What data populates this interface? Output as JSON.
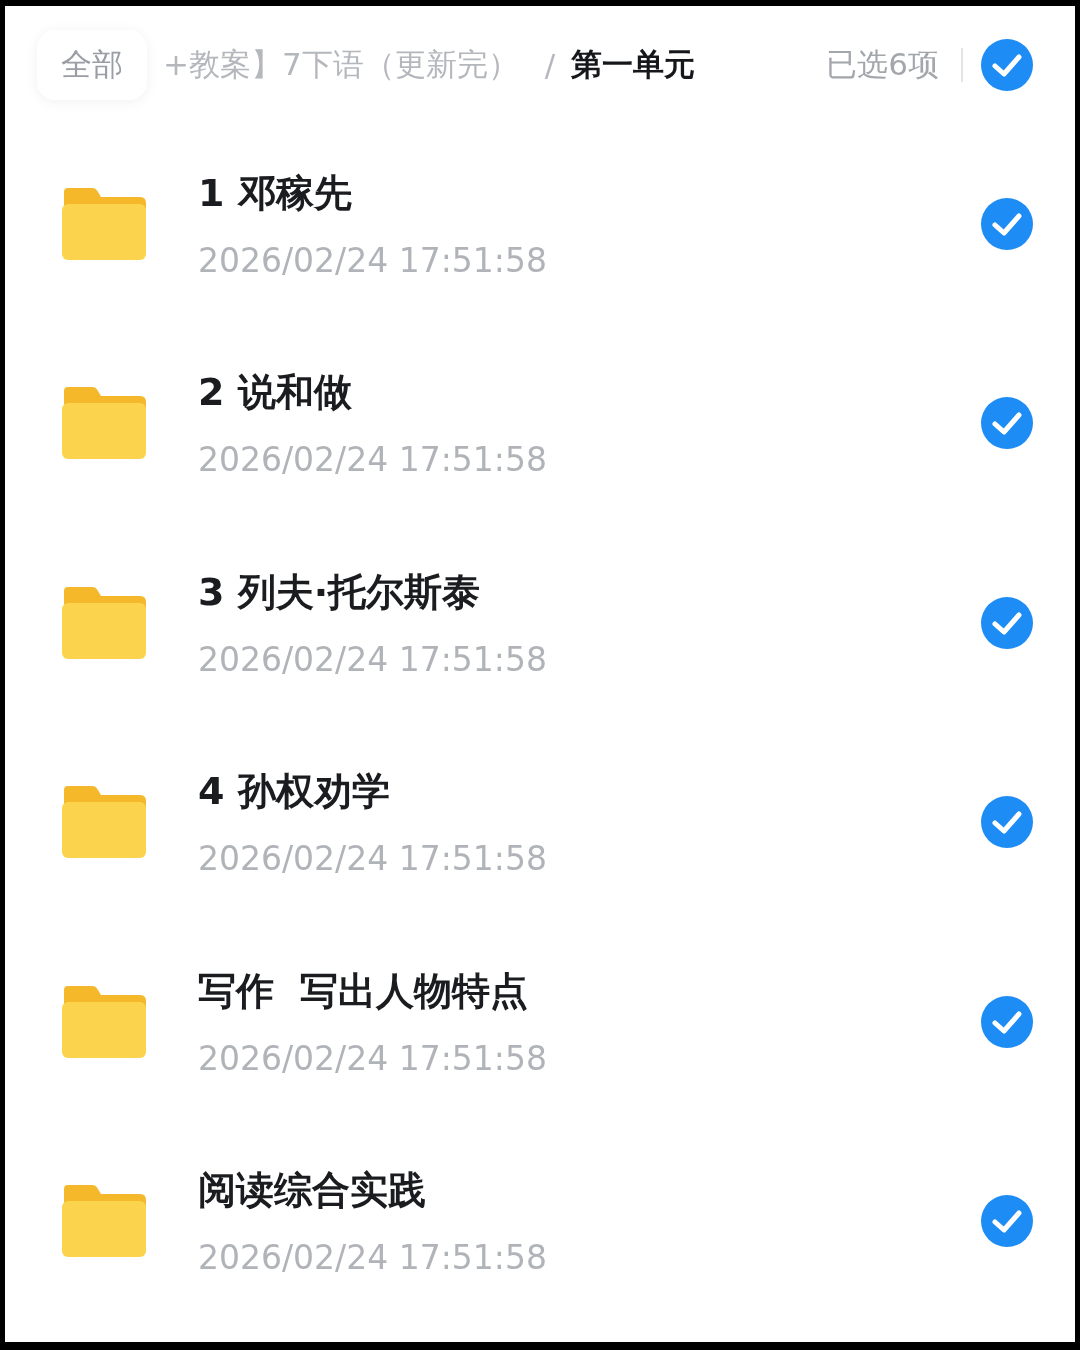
{
  "header": {
    "root_tab": "全部",
    "path": "+教案】7下语（更新完）",
    "separator": "/",
    "current": "第一单元",
    "selected_count": "已选6项",
    "select_all": {
      "checked": true
    }
  },
  "items": [
    {
      "title": "1 邓稼先",
      "date": "2026/02/24 17:51:58",
      "checked": true
    },
    {
      "title": "2 说和做",
      "date": "2026/02/24 17:51:58",
      "checked": true
    },
    {
      "title": "3 列夫·托尔斯泰",
      "date": "2026/02/24 17:51:58",
      "checked": true
    },
    {
      "title": "4 孙权劝学",
      "date": "2026/02/24 17:51:58",
      "checked": true
    },
    {
      "title": "写作  写出人物特点",
      "date": "2026/02/24 17:51:58",
      "checked": true
    },
    {
      "title": "阅读综合实践",
      "date": "2026/02/24 17:51:58",
      "checked": true
    }
  ]
}
